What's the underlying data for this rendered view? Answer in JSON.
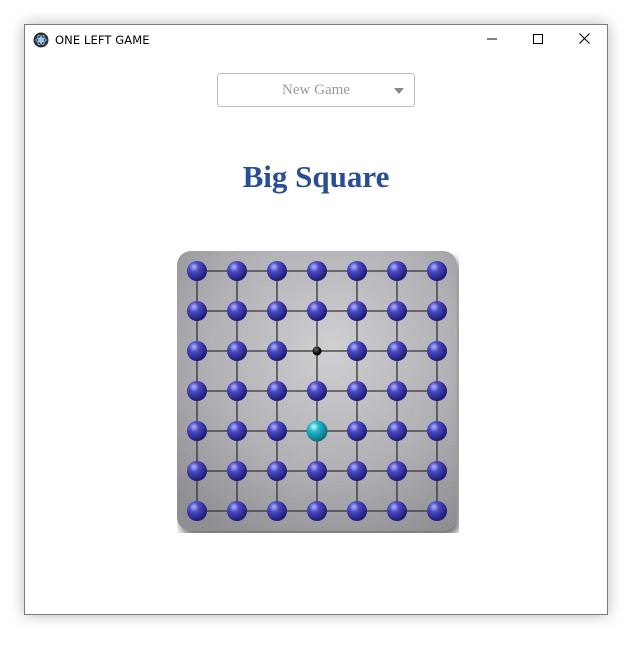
{
  "window": {
    "title": "ONE LEFT GAME",
    "icon": "app-logo-icon",
    "controls": {
      "minimize": "minimize-icon",
      "maximize": "maximize-icon",
      "close": "close-icon"
    }
  },
  "game_select": {
    "selected": "New Game",
    "icon": "chevron-down-icon"
  },
  "game": {
    "title": "Big Square",
    "board": {
      "rows": 7,
      "cols": 7,
      "empty": [
        [
          2,
          3
        ]
      ],
      "selected": [
        [
          4,
          3
        ]
      ],
      "colors": {
        "peg": "#3f3fb0",
        "selected_peg": "#1fb3c8",
        "hole": "#111111",
        "board": "#a9a9ad",
        "grid_line": "#333333"
      }
    }
  }
}
